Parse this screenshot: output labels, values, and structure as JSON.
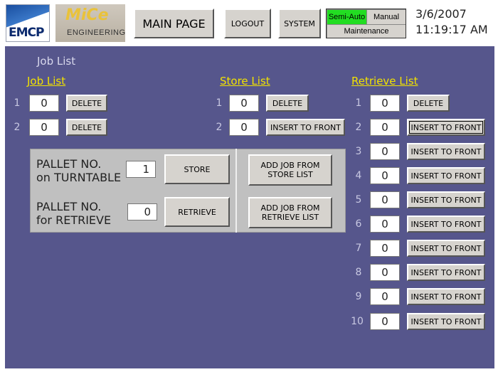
{
  "header": {
    "logo_emcp": "EMCP",
    "logo_mice": "MiCe",
    "logo_engineering": "ENGINEERING",
    "main_page": "MAIN PAGE",
    "logout": "LOGOUT",
    "system": "SYSTEM",
    "mode_semi_auto": "Semi-Auto",
    "mode_manual": "Manual",
    "mode_maintenance": "Maintenance",
    "date": "3/6/2007",
    "time": "11:19:17 AM",
    "colors": {
      "semi_auto_active": "#22dd22"
    }
  },
  "page": {
    "heading": "Job List",
    "colors": {
      "background": "#56568c",
      "column_title": "#f2e200"
    }
  },
  "job_list": {
    "title": "Job List",
    "rows": [
      {
        "num": "1",
        "value": "0",
        "button": "DELETE"
      },
      {
        "num": "2",
        "value": "0",
        "button": "DELETE"
      }
    ]
  },
  "store_list": {
    "title": "Store List",
    "rows": [
      {
        "num": "1",
        "value": "0",
        "button": "DELETE"
      },
      {
        "num": "2",
        "value": "0",
        "button": "INSERT TO FRONT"
      }
    ]
  },
  "retrieve_list": {
    "title": "Retrieve List",
    "rows": [
      {
        "num": "1",
        "value": "0",
        "button": "DELETE"
      },
      {
        "num": "2",
        "value": "0",
        "button": "INSERT TO FRONT"
      },
      {
        "num": "3",
        "value": "0",
        "button": "INSERT TO FRONT"
      },
      {
        "num": "4",
        "value": "0",
        "button": "INSERT TO FRONT"
      },
      {
        "num": "5",
        "value": "0",
        "button": "INSERT TO FRONT"
      },
      {
        "num": "6",
        "value": "0",
        "button": "INSERT TO FRONT"
      },
      {
        "num": "7",
        "value": "0",
        "button": "INSERT TO FRONT"
      },
      {
        "num": "8",
        "value": "0",
        "button": "INSERT TO FRONT"
      },
      {
        "num": "9",
        "value": "0",
        "button": "INSERT TO FRONT"
      },
      {
        "num": "10",
        "value": "0",
        "button": "INSERT TO FRONT"
      }
    ]
  },
  "pallet_panel": {
    "turntable_label_1": "PALLET NO.",
    "turntable_label_2": "on TURNTABLE",
    "turntable_value": "1",
    "store_button": "STORE",
    "retrieve_label_1": "PALLET NO.",
    "retrieve_label_2": "for RETRIEVE",
    "retrieve_value": "0",
    "retrieve_button": "RETRIEVE",
    "add_from_store_1": "ADD JOB FROM",
    "add_from_store_2": "STORE LIST",
    "add_from_retrieve_1": "ADD JOB FROM",
    "add_from_retrieve_2": "RETRIEVE LIST"
  }
}
